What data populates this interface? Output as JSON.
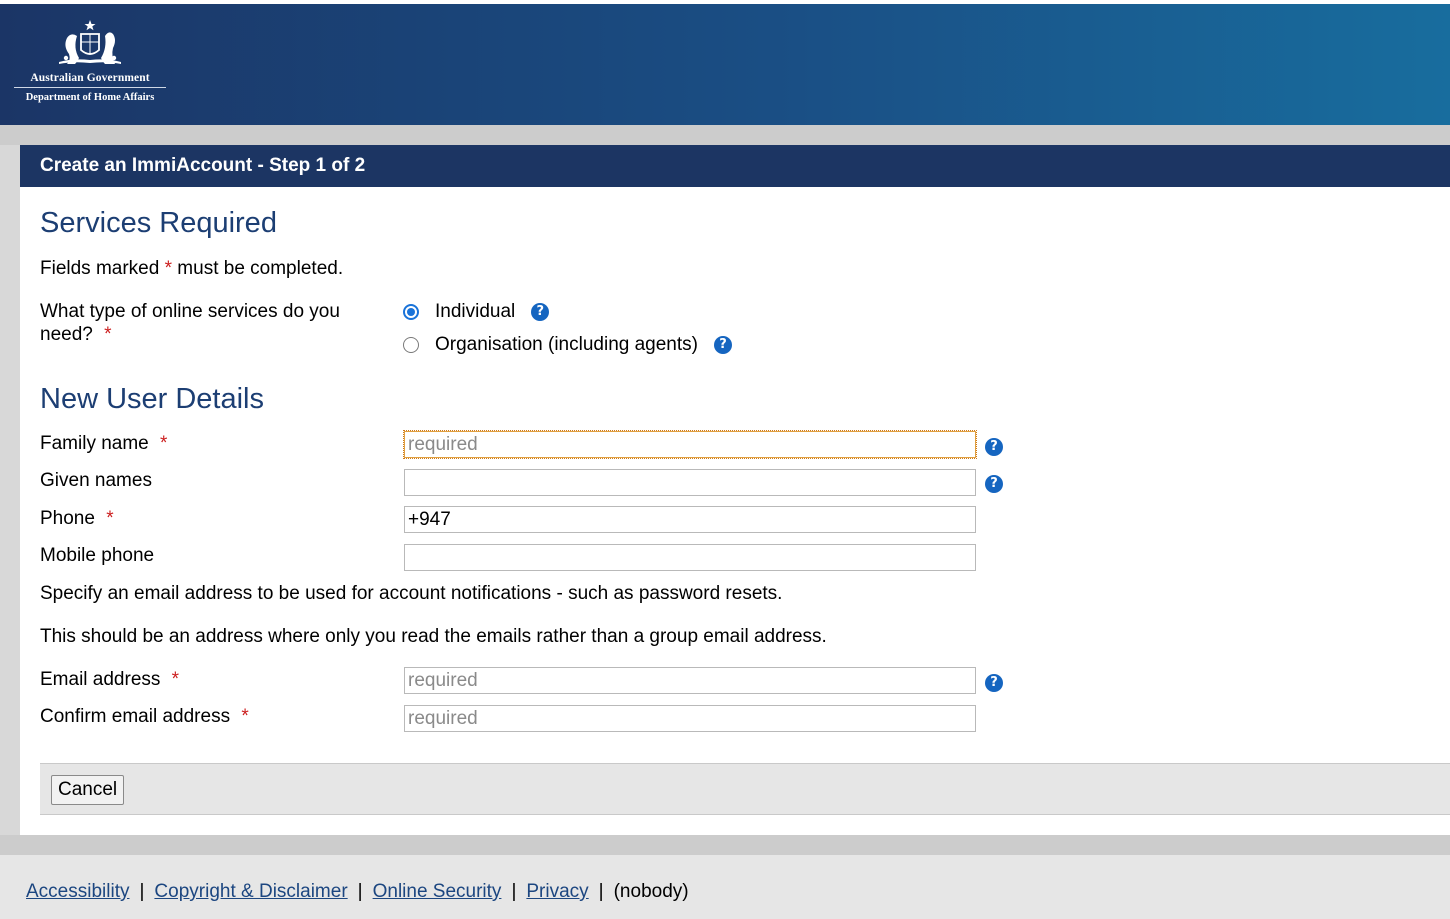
{
  "header": {
    "gov_name": "Australian Government",
    "department": "Department of Home Affairs"
  },
  "panel": {
    "title": "Create an ImmiAccount - Step 1 of 2"
  },
  "services": {
    "heading": "Services Required",
    "fields_note_pre": "Fields marked",
    "fields_note_post": "must be completed.",
    "question": "What type of online services do you need?",
    "options": [
      {
        "label": "Individual",
        "selected": true
      },
      {
        "label": "Organisation (including agents)",
        "selected": false
      }
    ]
  },
  "user": {
    "heading": "New User Details",
    "family_name": {
      "label": "Family name",
      "placeholder": "required",
      "value": ""
    },
    "given_names": {
      "label": "Given names",
      "placeholder": "",
      "value": ""
    },
    "phone": {
      "label": "Phone",
      "value": "+947"
    },
    "mobile": {
      "label": "Mobile phone",
      "value": ""
    },
    "email_note_1": "Specify an email address to be used for account notifications - such as password resets.",
    "email_note_2": "This should be an address where only you read the emails rather than a group email address.",
    "email": {
      "label": "Email address",
      "placeholder": "required"
    },
    "confirm_email": {
      "label": "Confirm email address",
      "placeholder": "required"
    }
  },
  "buttons": {
    "cancel": "Cancel"
  },
  "required_marker": "*",
  "help_glyph": "?",
  "footer": {
    "links": [
      "Accessibility",
      "Copyright & Disclaimer",
      "Online Security",
      "Privacy"
    ],
    "separator": "|",
    "user": "(nobody)"
  },
  "colors": {
    "header_start": "#1b3566",
    "header_end": "#186d9e",
    "panel_title_bg": "#1c3563",
    "heading_text": "#1c3e73",
    "required": "#cc1f1f",
    "help_icon": "#1565c0",
    "link": "#1c4680"
  },
  "icons": {
    "crest": "coat-of-arms-icon",
    "help": "question-circle-icon",
    "radio": "radio-button"
  }
}
